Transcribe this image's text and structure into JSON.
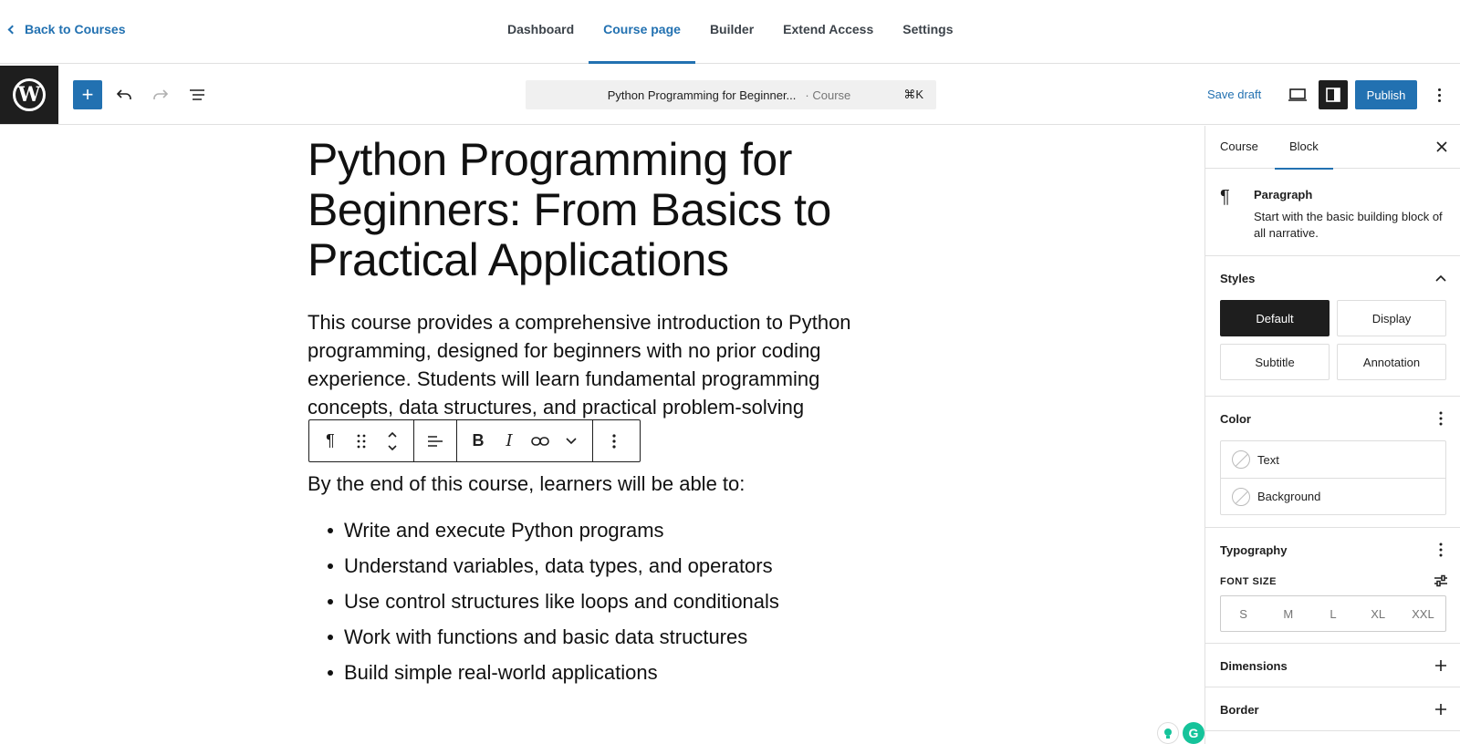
{
  "topnav": {
    "back_label": "Back to Courses",
    "tabs": [
      {
        "label": "Dashboard"
      },
      {
        "label": "Course page"
      },
      {
        "label": "Builder"
      },
      {
        "label": "Extend Access"
      },
      {
        "label": "Settings"
      }
    ],
    "active_tab": "Course page"
  },
  "editor_header": {
    "logo": "W",
    "inserter_icon": "+",
    "document_title": "Python Programming for Beginner...",
    "post_type": "· Course",
    "shortcut": "⌘K",
    "save_draft_label": "Save draft",
    "publish_label": "Publish"
  },
  "content": {
    "title": "Python Programming for Beginners: From Basics to Practical Applications",
    "intro": "This course provides a comprehensive introduction to Python programming, designed for beginners with no prior coding experience. Students will learn fundamental programming concepts, data structures, and practical problem-solving",
    "outcomes_lead": "By the end of this course, learners will be able to:",
    "outcomes": [
      "Write and execute Python programs",
      "Understand variables, data types, and operators",
      "Use control structures like loops and conditionals",
      "Work with functions and basic data structures",
      "Build simple real-world applications"
    ]
  },
  "block_toolbar": {
    "paragraph_glyph": "¶",
    "bold_glyph": "B",
    "italic_glyph": "I"
  },
  "sidebar": {
    "tabs": [
      "Course",
      "Block"
    ],
    "active_tab": "Block",
    "block": {
      "icon": "¶",
      "name": "Paragraph",
      "description": "Start with the basic building block of all narrative."
    },
    "styles": {
      "title": "Styles",
      "options": [
        "Default",
        "Display",
        "Subtitle",
        "Annotation"
      ],
      "active": "Default"
    },
    "color": {
      "title": "Color",
      "items": [
        "Text",
        "Background"
      ]
    },
    "typography": {
      "title": "Typography",
      "font_size_label": "FONT SIZE",
      "sizes": [
        "S",
        "M",
        "L",
        "XL",
        "XXL"
      ]
    },
    "dimensions_title": "Dimensions",
    "border_title": "Border"
  },
  "colors": {
    "accent": "#2271b1",
    "dark": "#1e1e1e",
    "grammarly": "#15c39a"
  }
}
